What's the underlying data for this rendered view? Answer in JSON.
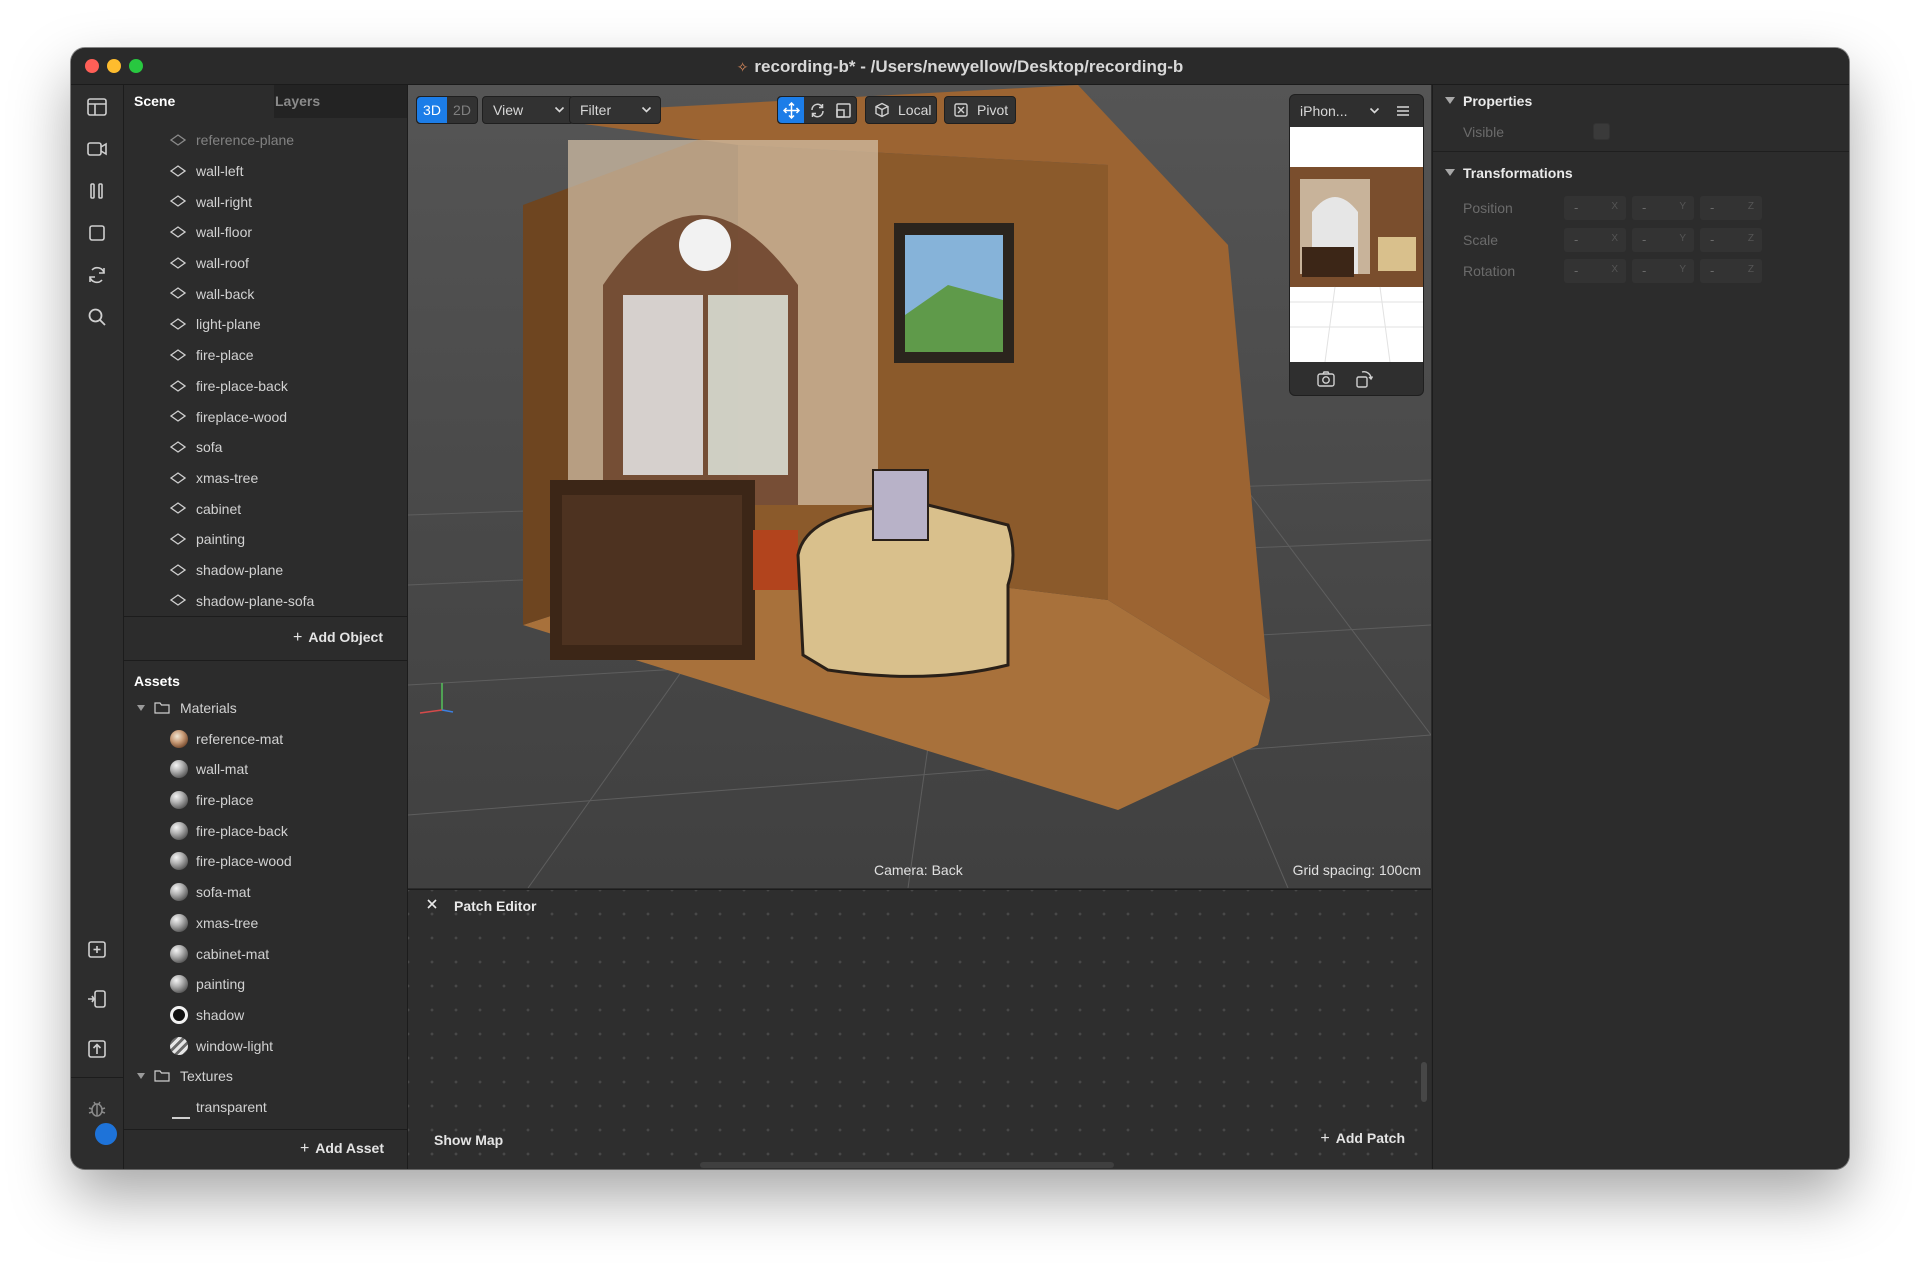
{
  "window": {
    "title": "recording-b* - /Users/newyellow/Desktop/recording-b"
  },
  "toolbar": {
    "icons": [
      "layout-icon",
      "video-icon",
      "pause-icon",
      "stop-icon",
      "refresh-icon",
      "search-icon",
      "new-file-icon",
      "device-icon",
      "upload-icon",
      "bug-icon",
      "notification-icon"
    ]
  },
  "scene": {
    "tabs": [
      "Scene",
      "Layers"
    ],
    "objects": [
      {
        "label": "reference-plane",
        "dim": true
      },
      {
        "label": "wall-left"
      },
      {
        "label": "wall-right"
      },
      {
        "label": "wall-floor"
      },
      {
        "label": "wall-roof"
      },
      {
        "label": "wall-back"
      },
      {
        "label": "light-plane"
      },
      {
        "label": "fire-place"
      },
      {
        "label": "fire-place-back"
      },
      {
        "label": "fireplace-wood"
      },
      {
        "label": "sofa"
      },
      {
        "label": "xmas-tree"
      },
      {
        "label": "cabinet"
      },
      {
        "label": "painting"
      },
      {
        "label": "shadow-plane"
      },
      {
        "label": "shadow-plane-sofa"
      }
    ],
    "add_object": "Add Object"
  },
  "assets": {
    "title": "Assets",
    "materials_folder": "Materials",
    "materials": [
      {
        "label": "reference-mat",
        "swatch": "ref"
      },
      {
        "label": "wall-mat",
        "swatch": "grey"
      },
      {
        "label": "fire-place",
        "swatch": "grey"
      },
      {
        "label": "fire-place-back",
        "swatch": "grey"
      },
      {
        "label": "fire-place-wood",
        "swatch": "grey"
      },
      {
        "label": "sofa-mat",
        "swatch": "grey"
      },
      {
        "label": "xmas-tree",
        "swatch": "grey"
      },
      {
        "label": "cabinet-mat",
        "swatch": "grey"
      },
      {
        "label": "painting",
        "swatch": "grey"
      },
      {
        "label": "shadow",
        "swatch": "shadow"
      },
      {
        "label": "window-light",
        "swatch": "stripe"
      }
    ],
    "textures_folder": "Textures",
    "textures": [
      {
        "label": "transparent"
      }
    ],
    "add_asset": "Add Asset"
  },
  "viewport": {
    "mode_3d": "3D",
    "mode_2d": "2D",
    "view_label": "View",
    "filter_label": "Filter",
    "local_label": "Local",
    "pivot_label": "Pivot",
    "device_label": "iPhon...",
    "camera_label": "Camera: Back",
    "grid_label": "Grid spacing: 100cm"
  },
  "patch_editor": {
    "title": "Patch Editor",
    "show_map": "Show Map",
    "add_patch": "Add Patch"
  },
  "properties": {
    "title": "Properties",
    "visible_label": "Visible",
    "visible_checked": false,
    "transform_title": "Transformations",
    "rows": [
      {
        "label": "Position",
        "values": [
          "-",
          "-",
          "-"
        ],
        "axes": [
          "X",
          "Y",
          "Z"
        ]
      },
      {
        "label": "Scale",
        "values": [
          "-",
          "-",
          "-"
        ],
        "axes": [
          "X",
          "Y",
          "Z"
        ]
      },
      {
        "label": "Rotation",
        "values": [
          "-",
          "-",
          "-"
        ],
        "axes": [
          "X",
          "Y",
          "Z"
        ]
      }
    ]
  },
  "colors": {
    "accent": "#1c7de8",
    "panel": "#2c2c2c",
    "wood": "#8b5a2b",
    "floor": "#a8713b"
  }
}
